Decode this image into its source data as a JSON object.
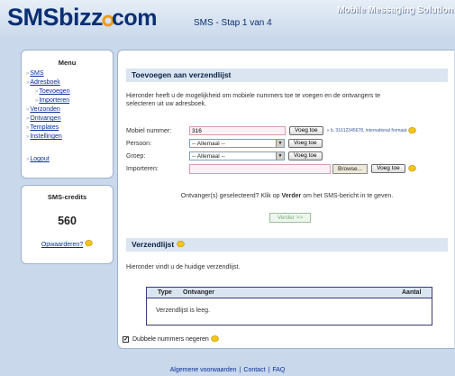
{
  "header": {
    "logo_main": "SMSbizz",
    "logo_suffix": "com",
    "page_title": "SMS - Stap 1 van 4",
    "tagline": "Mobile Messaging Solution"
  },
  "menu": {
    "title": "Menu",
    "items": [
      {
        "label": "SMS"
      },
      {
        "label": "Adresboek"
      },
      {
        "label": "Toevoegen"
      },
      {
        "label": "Importeren"
      },
      {
        "label": "Verzonden"
      },
      {
        "label": "Ontvangen"
      },
      {
        "label": "Templates"
      },
      {
        "label": "Instellingen"
      },
      {
        "label": "Logout"
      }
    ]
  },
  "credits": {
    "title": "SMS-credits",
    "value": "560",
    "topup_label": "Opwaarderen?"
  },
  "add_section": {
    "title": "Toevoegen aan verzendlijst",
    "intro_line1": "Hieronder heeft u de mogelijkheid om mobiele nummers toe te voegen en de ontvangers te",
    "intro_line2": "selecteren uit uw adresboek.",
    "mobile_label": "Mobiel nummer:",
    "mobile_value": "316",
    "add_button": "Voeg toe",
    "mobile_hint": "» b. 31612345678, international formaat",
    "person_label": "Persoon:",
    "person_value": "-- Allemaal --",
    "group_label": "Groep:",
    "group_value": "-- Allemaal --",
    "import_label": "Importeren:",
    "browse_button": "Browse...",
    "ready_text_before": "Ontvanger(s) geselecteerd? Klik op ",
    "ready_text_bold": "Verder",
    "ready_text_after": " om het SMS-bericht in te geven.",
    "next_button": "Verder >>"
  },
  "list_section": {
    "title": "Verzendlijst",
    "intro": "Hieronder vindt u de huidige verzendlijst.",
    "columns": {
      "type": "Type",
      "recipient": "Ontvanger",
      "count": "Aantal"
    },
    "empty_text": "Verzendlijst is leeg.",
    "dedupe_label": "Dubbele nummers negeren",
    "dedupe_checked": true
  },
  "footer": {
    "terms": "Algemene voorwaarden",
    "contact": "Contact",
    "faq": "FAQ",
    "separator": "|"
  },
  "colors": {
    "brand_blue": "#0a2f74",
    "accent_orange": "#f29a14",
    "section_bar": "#dbe5f2",
    "background": "#c9d8ea"
  },
  "icons": [
    "lightbulb-help-icon",
    "checkbox-icon",
    "dropdown-arrow-icon"
  ]
}
